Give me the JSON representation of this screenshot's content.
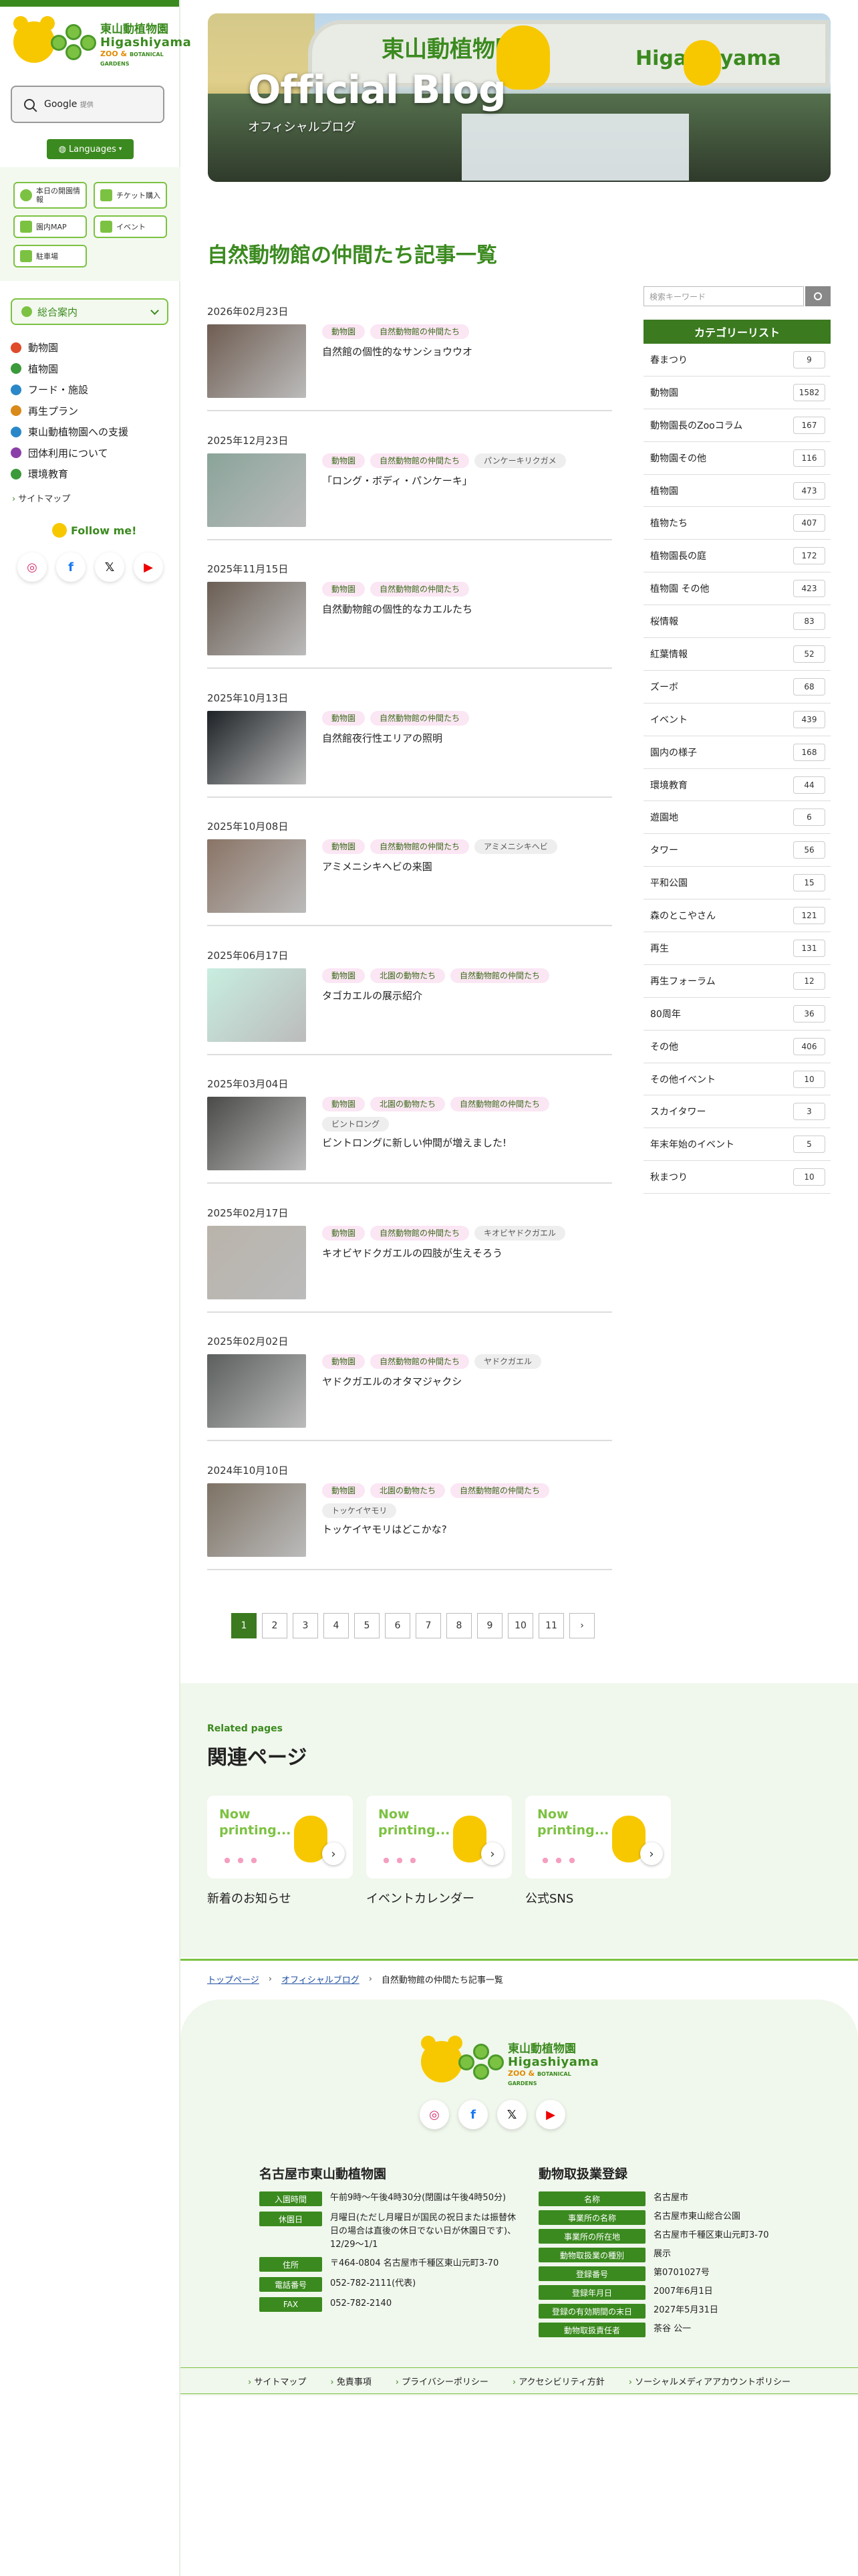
{
  "sidebar": {
    "logo": {
      "jp": "東山動植物園",
      "en": "Higashiyama",
      "sub1": "ZOO &",
      "sub2": "BOTANICAL GARDENS"
    },
    "search": {
      "brand": "Google",
      "label": "提供"
    },
    "languages": "Languages",
    "quick": [
      {
        "label": "本日の開園情報"
      },
      {
        "label": "チケット購入"
      },
      {
        "label": "園内MAP"
      },
      {
        "label": "イベント"
      },
      {
        "label": "駐車場"
      }
    ],
    "menu_head": "総合案内",
    "menu": [
      {
        "label": "動物園",
        "color": "#e04b2a"
      },
      {
        "label": "植物園",
        "color": "#3b9a3a"
      },
      {
        "label": "フード・施設",
        "color": "#2a88c8"
      },
      {
        "label": "再生プラン",
        "color": "#d98a1a"
      },
      {
        "label": "東山動植物園への支援",
        "color": "#2a88c8"
      },
      {
        "label": "団体利用について",
        "color": "#8a3fa8"
      },
      {
        "label": "環境教育",
        "color": "#3b9a3a"
      }
    ],
    "sitemap": "サイトマップ",
    "follow": "Follow me!",
    "socials": [
      "instagram-icon",
      "facebook-icon",
      "x-icon",
      "youtube-icon"
    ]
  },
  "hero": {
    "title": "Official Blog",
    "subtitle": "オフィシャルブログ",
    "sign_jp": "東山動植物園",
    "sign_en": "Higashiyama"
  },
  "page_title": "自然動物館の仲間たち記事一覧",
  "articles": [
    {
      "date": "2026年02月23日",
      "tags": [
        [
          "動物園",
          "p"
        ],
        [
          "自然動物館の仲間たち",
          "p"
        ]
      ],
      "title": "自然館の個性的なサンショウウオ",
      "thumb": "#6f5d52"
    },
    {
      "date": "2025年12月23日",
      "tags": [
        [
          "動物園",
          "p"
        ],
        [
          "自然動物館の仲間たち",
          "p"
        ],
        [
          "パンケーキリクガメ",
          "g"
        ]
      ],
      "title": "「ロング・ボディ・パンケーキ」",
      "thumb": "#8aa49a"
    },
    {
      "date": "2025年11月15日",
      "tags": [
        [
          "動物園",
          "p"
        ],
        [
          "自然動物館の仲間たち",
          "p"
        ]
      ],
      "title": "自然動物館の個性的なカエルたち",
      "thumb": "#6b5e54"
    },
    {
      "date": "2025年10月13日",
      "tags": [
        [
          "動物園",
          "p"
        ],
        [
          "自然動物館の仲間たち",
          "p"
        ]
      ],
      "title": "自然館夜行性エリアの照明",
      "thumb": "#1d2226"
    },
    {
      "date": "2025年10月08日",
      "tags": [
        [
          "動物園",
          "p"
        ],
        [
          "自然動物館の仲間たち",
          "p"
        ],
        [
          "アミメニシキヘビ",
          "g"
        ]
      ],
      "title": "アミメニシキヘビの来園",
      "thumb": "#8a7466"
    },
    {
      "date": "2025年06月17日",
      "tags": [
        [
          "動物園",
          "p"
        ],
        [
          "北園の動物たち",
          "p"
        ],
        [
          "自然動物館の仲間たち",
          "p"
        ]
      ],
      "title": "タゴカエルの展示紹介",
      "thumb": "#c8eee0"
    },
    {
      "date": "2025年03月04日",
      "tags": [
        [
          "動物園",
          "p"
        ],
        [
          "北園の動物たち",
          "p"
        ],
        [
          "自然動物館の仲間たち",
          "p"
        ],
        [
          "ビントロング",
          "g"
        ]
      ],
      "title": "ビントロングに新しい仲間が増えました!",
      "thumb": "#4a4a48"
    },
    {
      "date": "2025年02月17日",
      "tags": [
        [
          "動物園",
          "p"
        ],
        [
          "自然動物館の仲間たち",
          "p"
        ],
        [
          "キオビヤドクガエル",
          "g"
        ]
      ],
      "title": "キオビヤドクガエルの四肢が生えそろう",
      "thumb": "#b9b3aa"
    },
    {
      "date": "2025年02月02日",
      "tags": [
        [
          "動物園",
          "p"
        ],
        [
          "自然動物館の仲間たち",
          "p"
        ],
        [
          "ヤドクガエル",
          "g"
        ]
      ],
      "title": "ヤドクガエルのオタマジャクシ",
      "thumb": "#5b5f5e"
    },
    {
      "date": "2024年10月10日",
      "tags": [
        [
          "動物園",
          "p"
        ],
        [
          "北園の動物たち",
          "p"
        ],
        [
          "自然動物館の仲間たち",
          "p"
        ],
        [
          "トッケイヤモリ",
          "g"
        ]
      ],
      "title": "トッケイヤモリはどこかな?",
      "thumb": "#7d7264"
    }
  ],
  "pagination": [
    "1",
    "2",
    "3",
    "4",
    "5",
    "6",
    "7",
    "8",
    "9",
    "10",
    "11",
    "›"
  ],
  "search_kw": {
    "placeholder": "検索キーワード"
  },
  "category_head": "カテゴリーリスト",
  "categories": [
    {
      "name": "春まつり",
      "count": "9"
    },
    {
      "name": "動物園",
      "count": "1582"
    },
    {
      "name": "動物園長のZooコラム",
      "count": "167"
    },
    {
      "name": "動物園その他",
      "count": "116"
    },
    {
      "name": "植物園",
      "count": "473"
    },
    {
      "name": "植物たち",
      "count": "407"
    },
    {
      "name": "植物園長の庭",
      "count": "172"
    },
    {
      "name": "植物園 その他",
      "count": "423"
    },
    {
      "name": "桜情報",
      "count": "83"
    },
    {
      "name": "紅葉情報",
      "count": "52"
    },
    {
      "name": "ズーボ",
      "count": "68"
    },
    {
      "name": "イベント",
      "count": "439"
    },
    {
      "name": "園内の様子",
      "count": "168"
    },
    {
      "name": "環境教育",
      "count": "44"
    },
    {
      "name": "遊園地",
      "count": "6"
    },
    {
      "name": "タワー",
      "count": "56"
    },
    {
      "name": "平和公園",
      "count": "15"
    },
    {
      "name": "森のとこやさん",
      "count": "121"
    },
    {
      "name": "再生",
      "count": "131"
    },
    {
      "name": "再生フォーラム",
      "count": "12"
    },
    {
      "name": "80周年",
      "count": "36"
    },
    {
      "name": "その他",
      "count": "406"
    },
    {
      "name": "その他イベント",
      "count": "10"
    },
    {
      "name": "スカイタワー",
      "count": "3"
    },
    {
      "name": "年末年始のイベント",
      "count": "5"
    },
    {
      "name": "秋まつり",
      "count": "10"
    }
  ],
  "related": {
    "en": "Related pages",
    "jp": "関連ページ",
    "cards": [
      {
        "img_text": "Now printing...",
        "caption": "新着のお知らせ"
      },
      {
        "img_text": "Now printing...",
        "caption": "イベントカレンダー"
      },
      {
        "img_text": "Now printing...",
        "caption": "公式SNS"
      }
    ]
  },
  "breadcrumb": {
    "home": "トップページ",
    "blog": "オフィシャルブログ",
    "current": "自然動物館の仲間たち記事一覧"
  },
  "footer": {
    "org": "名古屋市東山動植物園",
    "rows": [
      {
        "label": "入園時間",
        "value": "午前9時〜午後4時30分(閉園は午後4時50分)"
      },
      {
        "label": "休園日",
        "value": "月曜日(ただし月曜日が国民の祝日または振替休日の場合は直後の休日でない日が休園日です)、12/29〜1/1"
      },
      {
        "label": "住所",
        "value": "〒464-0804 名古屋市千種区東山元町3-70"
      },
      {
        "label": "電話番号",
        "value": "052-782-2111(代表)"
      },
      {
        "label": "FAX",
        "value": "052-782-2140"
      }
    ],
    "reg_title": "動物取扱業登録",
    "reg_rows": [
      {
        "label": "名称",
        "value": "名古屋市"
      },
      {
        "label": "事業所の名称",
        "value": "名古屋市東山総合公園"
      },
      {
        "label": "事業所の所在地",
        "value": "名古屋市千種区東山元町3-70"
      },
      {
        "label": "動物取扱業の種別",
        "value": "展示"
      },
      {
        "label": "登録番号",
        "value": "第0701027号"
      },
      {
        "label": "登録年月日",
        "value": "2007年6月1日"
      },
      {
        "label": "登録の有効期間の末日",
        "value": "2027年5月31日"
      },
      {
        "label": "動物取扱責任者",
        "value": "茶谷 公一"
      }
    ],
    "nav": [
      "サイトマップ",
      "免責事項",
      "プライバシーポリシー",
      "アクセシビリティ方針",
      "ソーシャルメディアアカウントポリシー"
    ]
  }
}
